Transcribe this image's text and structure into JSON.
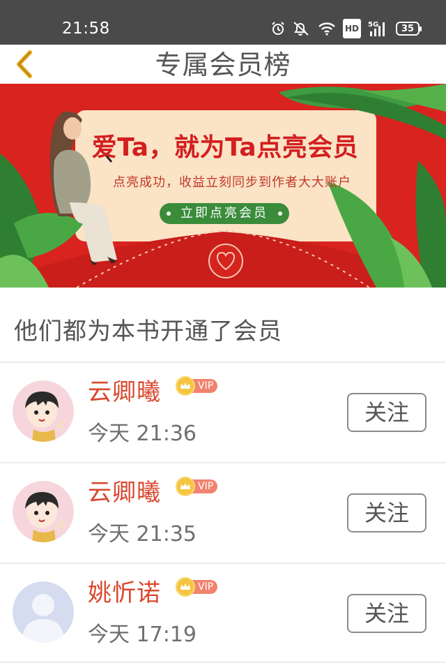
{
  "status_bar": {
    "time": "21:58",
    "icons": [
      "alarm-icon",
      "mute-icon",
      "wifi-icon",
      "hd-icon",
      "signal-5g-icon",
      "battery-icon"
    ],
    "hd_label": "HD",
    "network": "5G",
    "battery": "35"
  },
  "header": {
    "title": "专属会员榜",
    "back_icon": "chevron-left-icon",
    "accent_color": "#e2a617"
  },
  "banner": {
    "title": "爱Ta，就为Ta点亮会员",
    "subtitle": "点亮成功，收益立刻同步到作者大大账户",
    "button_label": "立即点亮会员",
    "background_color": "#d8231e"
  },
  "section": {
    "title": "他们都为本书开通了会员"
  },
  "members": [
    {
      "name": "云卿曦",
      "badge": "VIP",
      "time": "今天 21:36",
      "follow_label": "关注",
      "avatar": "cartoon-girl"
    },
    {
      "name": "云卿曦",
      "badge": "VIP",
      "time": "今天 21:35",
      "follow_label": "关注",
      "avatar": "cartoon-girl"
    },
    {
      "name": "姚忻诺",
      "badge": "VIP",
      "time": "今天 17:19",
      "follow_label": "关注",
      "avatar": "default-user"
    }
  ]
}
